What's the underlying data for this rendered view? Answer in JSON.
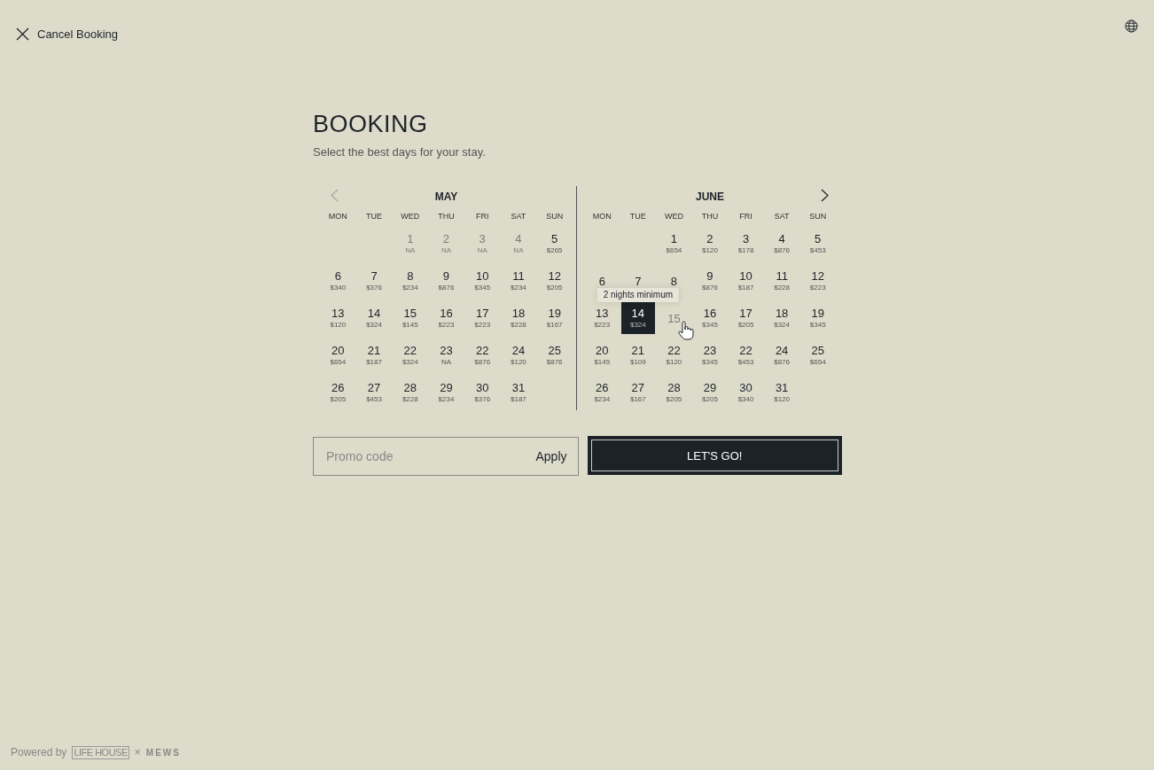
{
  "header": {
    "cancel_label": "Cancel Booking"
  },
  "title": "BOOKING",
  "subtitle": "Select the best days for your stay.",
  "months": [
    {
      "name": "MAY",
      "prev_button": {
        "disabled": true
      },
      "weekdays": [
        "MON",
        "TUE",
        "WED",
        "THU",
        "FRI",
        "SAT",
        "SUN"
      ],
      "weeks": [
        [
          {
            "kind": "empty"
          },
          {
            "kind": "empty"
          },
          {
            "kind": "day",
            "day": "1",
            "price": "NA",
            "disabled": true,
            "selected": false
          },
          {
            "kind": "day",
            "day": "2",
            "price": "NA",
            "disabled": true,
            "selected": false
          },
          {
            "kind": "day",
            "day": "3",
            "price": "NA",
            "disabled": true,
            "selected": false
          },
          {
            "kind": "day",
            "day": "4",
            "price": "NA",
            "disabled": true,
            "selected": false
          },
          {
            "kind": "day",
            "day": "5",
            "price": "$265",
            "disabled": false,
            "selected": false
          }
        ],
        [
          {
            "kind": "day",
            "day": "6",
            "price": "$340",
            "disabled": false,
            "selected": false
          },
          {
            "kind": "day",
            "day": "7",
            "price": "$376",
            "disabled": false,
            "selected": false
          },
          {
            "kind": "day",
            "day": "8",
            "price": "$234",
            "disabled": false,
            "selected": false
          },
          {
            "kind": "day",
            "day": "9",
            "price": "$876",
            "disabled": false,
            "selected": false
          },
          {
            "kind": "day",
            "day": "10",
            "price": "$345",
            "disabled": false,
            "selected": false
          },
          {
            "kind": "day",
            "day": "11",
            "price": "$234",
            "disabled": false,
            "selected": false
          },
          {
            "kind": "day",
            "day": "12",
            "price": "$205",
            "disabled": false,
            "selected": false
          }
        ],
        [
          {
            "kind": "day",
            "day": "13",
            "price": "$120",
            "disabled": false,
            "selected": false
          },
          {
            "kind": "day",
            "day": "14",
            "price": "$324",
            "disabled": false,
            "selected": false
          },
          {
            "kind": "day",
            "day": "15",
            "price": "$145",
            "disabled": false,
            "selected": false
          },
          {
            "kind": "day",
            "day": "16",
            "price": "$223",
            "disabled": false,
            "selected": false
          },
          {
            "kind": "day",
            "day": "17",
            "price": "$223",
            "disabled": false,
            "selected": false
          },
          {
            "kind": "day",
            "day": "18",
            "price": "$228",
            "disabled": false,
            "selected": false
          },
          {
            "kind": "day",
            "day": "19",
            "price": "$167",
            "disabled": false,
            "selected": false
          }
        ],
        [
          {
            "kind": "day",
            "day": "20",
            "price": "$654",
            "disabled": false,
            "selected": false
          },
          {
            "kind": "day",
            "day": "21",
            "price": "$187",
            "disabled": false,
            "selected": false
          },
          {
            "kind": "day",
            "day": "22",
            "price": "$324",
            "disabled": false,
            "selected": false
          },
          {
            "kind": "day",
            "day": "23",
            "price": "NA",
            "disabled": false,
            "selected": false
          },
          {
            "kind": "day",
            "day": "22",
            "price": "$876",
            "disabled": false,
            "selected": false
          },
          {
            "kind": "day",
            "day": "24",
            "price": "$120",
            "disabled": false,
            "selected": false
          },
          {
            "kind": "day",
            "day": "25",
            "price": "$876",
            "disabled": false,
            "selected": false
          }
        ],
        [
          {
            "kind": "day",
            "day": "26",
            "price": "$205",
            "disabled": false,
            "selected": false
          },
          {
            "kind": "day",
            "day": "27",
            "price": "$453",
            "disabled": false,
            "selected": false
          },
          {
            "kind": "day",
            "day": "28",
            "price": "$228",
            "disabled": false,
            "selected": false
          },
          {
            "kind": "day",
            "day": "29",
            "price": "$234",
            "disabled": false,
            "selected": false
          },
          {
            "kind": "day",
            "day": "30",
            "price": "$376",
            "disabled": false,
            "selected": false
          },
          {
            "kind": "day",
            "day": "31",
            "price": "$187",
            "disabled": false,
            "selected": false
          },
          {
            "kind": "empty"
          }
        ]
      ]
    },
    {
      "name": "JUNE",
      "next_button": {
        "disabled": false
      },
      "weekdays": [
        "MON",
        "TUE",
        "WED",
        "THU",
        "FRI",
        "SAT",
        "SUN"
      ],
      "weeks": [
        [
          {
            "kind": "empty"
          },
          {
            "kind": "empty"
          },
          {
            "kind": "day",
            "day": "1",
            "price": "$654",
            "disabled": false,
            "selected": false
          },
          {
            "kind": "day",
            "day": "2",
            "price": "$120",
            "disabled": false,
            "selected": false
          },
          {
            "kind": "day",
            "day": "3",
            "price": "$178",
            "disabled": false,
            "selected": false
          },
          {
            "kind": "day",
            "day": "4",
            "price": "$876",
            "disabled": false,
            "selected": false
          },
          {
            "kind": "day",
            "day": "5",
            "price": "$453",
            "disabled": false,
            "selected": false
          }
        ],
        [
          {
            "kind": "day",
            "day": "6",
            "disabled": false,
            "selected": false
          },
          {
            "kind": "day",
            "day": "7",
            "disabled": false,
            "selected": false
          },
          {
            "kind": "day",
            "day": "8",
            "disabled": false,
            "selected": false
          },
          {
            "kind": "day",
            "day": "9",
            "price": "$876",
            "disabled": false,
            "selected": false
          },
          {
            "kind": "day",
            "day": "10",
            "price": "$187",
            "disabled": false,
            "selected": false
          },
          {
            "kind": "day",
            "day": "11",
            "price": "$228",
            "disabled": false,
            "selected": false
          },
          {
            "kind": "day",
            "day": "12",
            "price": "$223",
            "disabled": false,
            "selected": false
          }
        ],
        [
          {
            "kind": "day",
            "day": "13",
            "price": "$223",
            "disabled": false,
            "selected": false
          },
          {
            "kind": "day",
            "day": "14",
            "price": "$324",
            "disabled": false,
            "selected": true,
            "tooltip": "2 nights minimum"
          },
          {
            "kind": "day",
            "day": "15",
            "disabled": true,
            "selected": false,
            "hovered": true
          },
          {
            "kind": "day",
            "day": "16",
            "price": "$345",
            "disabled": false,
            "selected": false
          },
          {
            "kind": "day",
            "day": "17",
            "price": "$205",
            "disabled": false,
            "selected": false
          },
          {
            "kind": "day",
            "day": "18",
            "price": "$324",
            "disabled": false,
            "selected": false
          },
          {
            "kind": "day",
            "day": "19",
            "price": "$345",
            "disabled": false,
            "selected": false
          }
        ],
        [
          {
            "kind": "day",
            "day": "20",
            "price": "$145",
            "disabled": false,
            "selected": false
          },
          {
            "kind": "day",
            "day": "21",
            "price": "$109",
            "disabled": false,
            "selected": false
          },
          {
            "kind": "day",
            "day": "22",
            "price": "$120",
            "disabled": false,
            "selected": false
          },
          {
            "kind": "day",
            "day": "23",
            "price": "$345",
            "disabled": false,
            "selected": false
          },
          {
            "kind": "day",
            "day": "22",
            "price": "$453",
            "disabled": false,
            "selected": false
          },
          {
            "kind": "day",
            "day": "24",
            "price": "$876",
            "disabled": false,
            "selected": false
          },
          {
            "kind": "day",
            "day": "25",
            "price": "$654",
            "disabled": false,
            "selected": false
          }
        ],
        [
          {
            "kind": "day",
            "day": "26",
            "price": "$234",
            "disabled": false,
            "selected": false
          },
          {
            "kind": "day",
            "day": "27",
            "price": "$167",
            "disabled": false,
            "selected": false
          },
          {
            "kind": "day",
            "day": "28",
            "price": "$205",
            "disabled": false,
            "selected": false
          },
          {
            "kind": "day",
            "day": "29",
            "price": "$205",
            "disabled": false,
            "selected": false
          },
          {
            "kind": "day",
            "day": "30",
            "price": "$340",
            "disabled": false,
            "selected": false
          },
          {
            "kind": "day",
            "day": "31",
            "price": "$120",
            "disabled": false,
            "selected": false
          },
          {
            "kind": "empty"
          }
        ]
      ]
    }
  ],
  "promo": {
    "placeholder": "Promo code",
    "apply_label": "Apply"
  },
  "submit_label": "LET'S GO!",
  "footer": {
    "powered_by": "Powered by",
    "brand": "LIFE HOUSE",
    "separator": "×",
    "partner": "MEWS"
  }
}
